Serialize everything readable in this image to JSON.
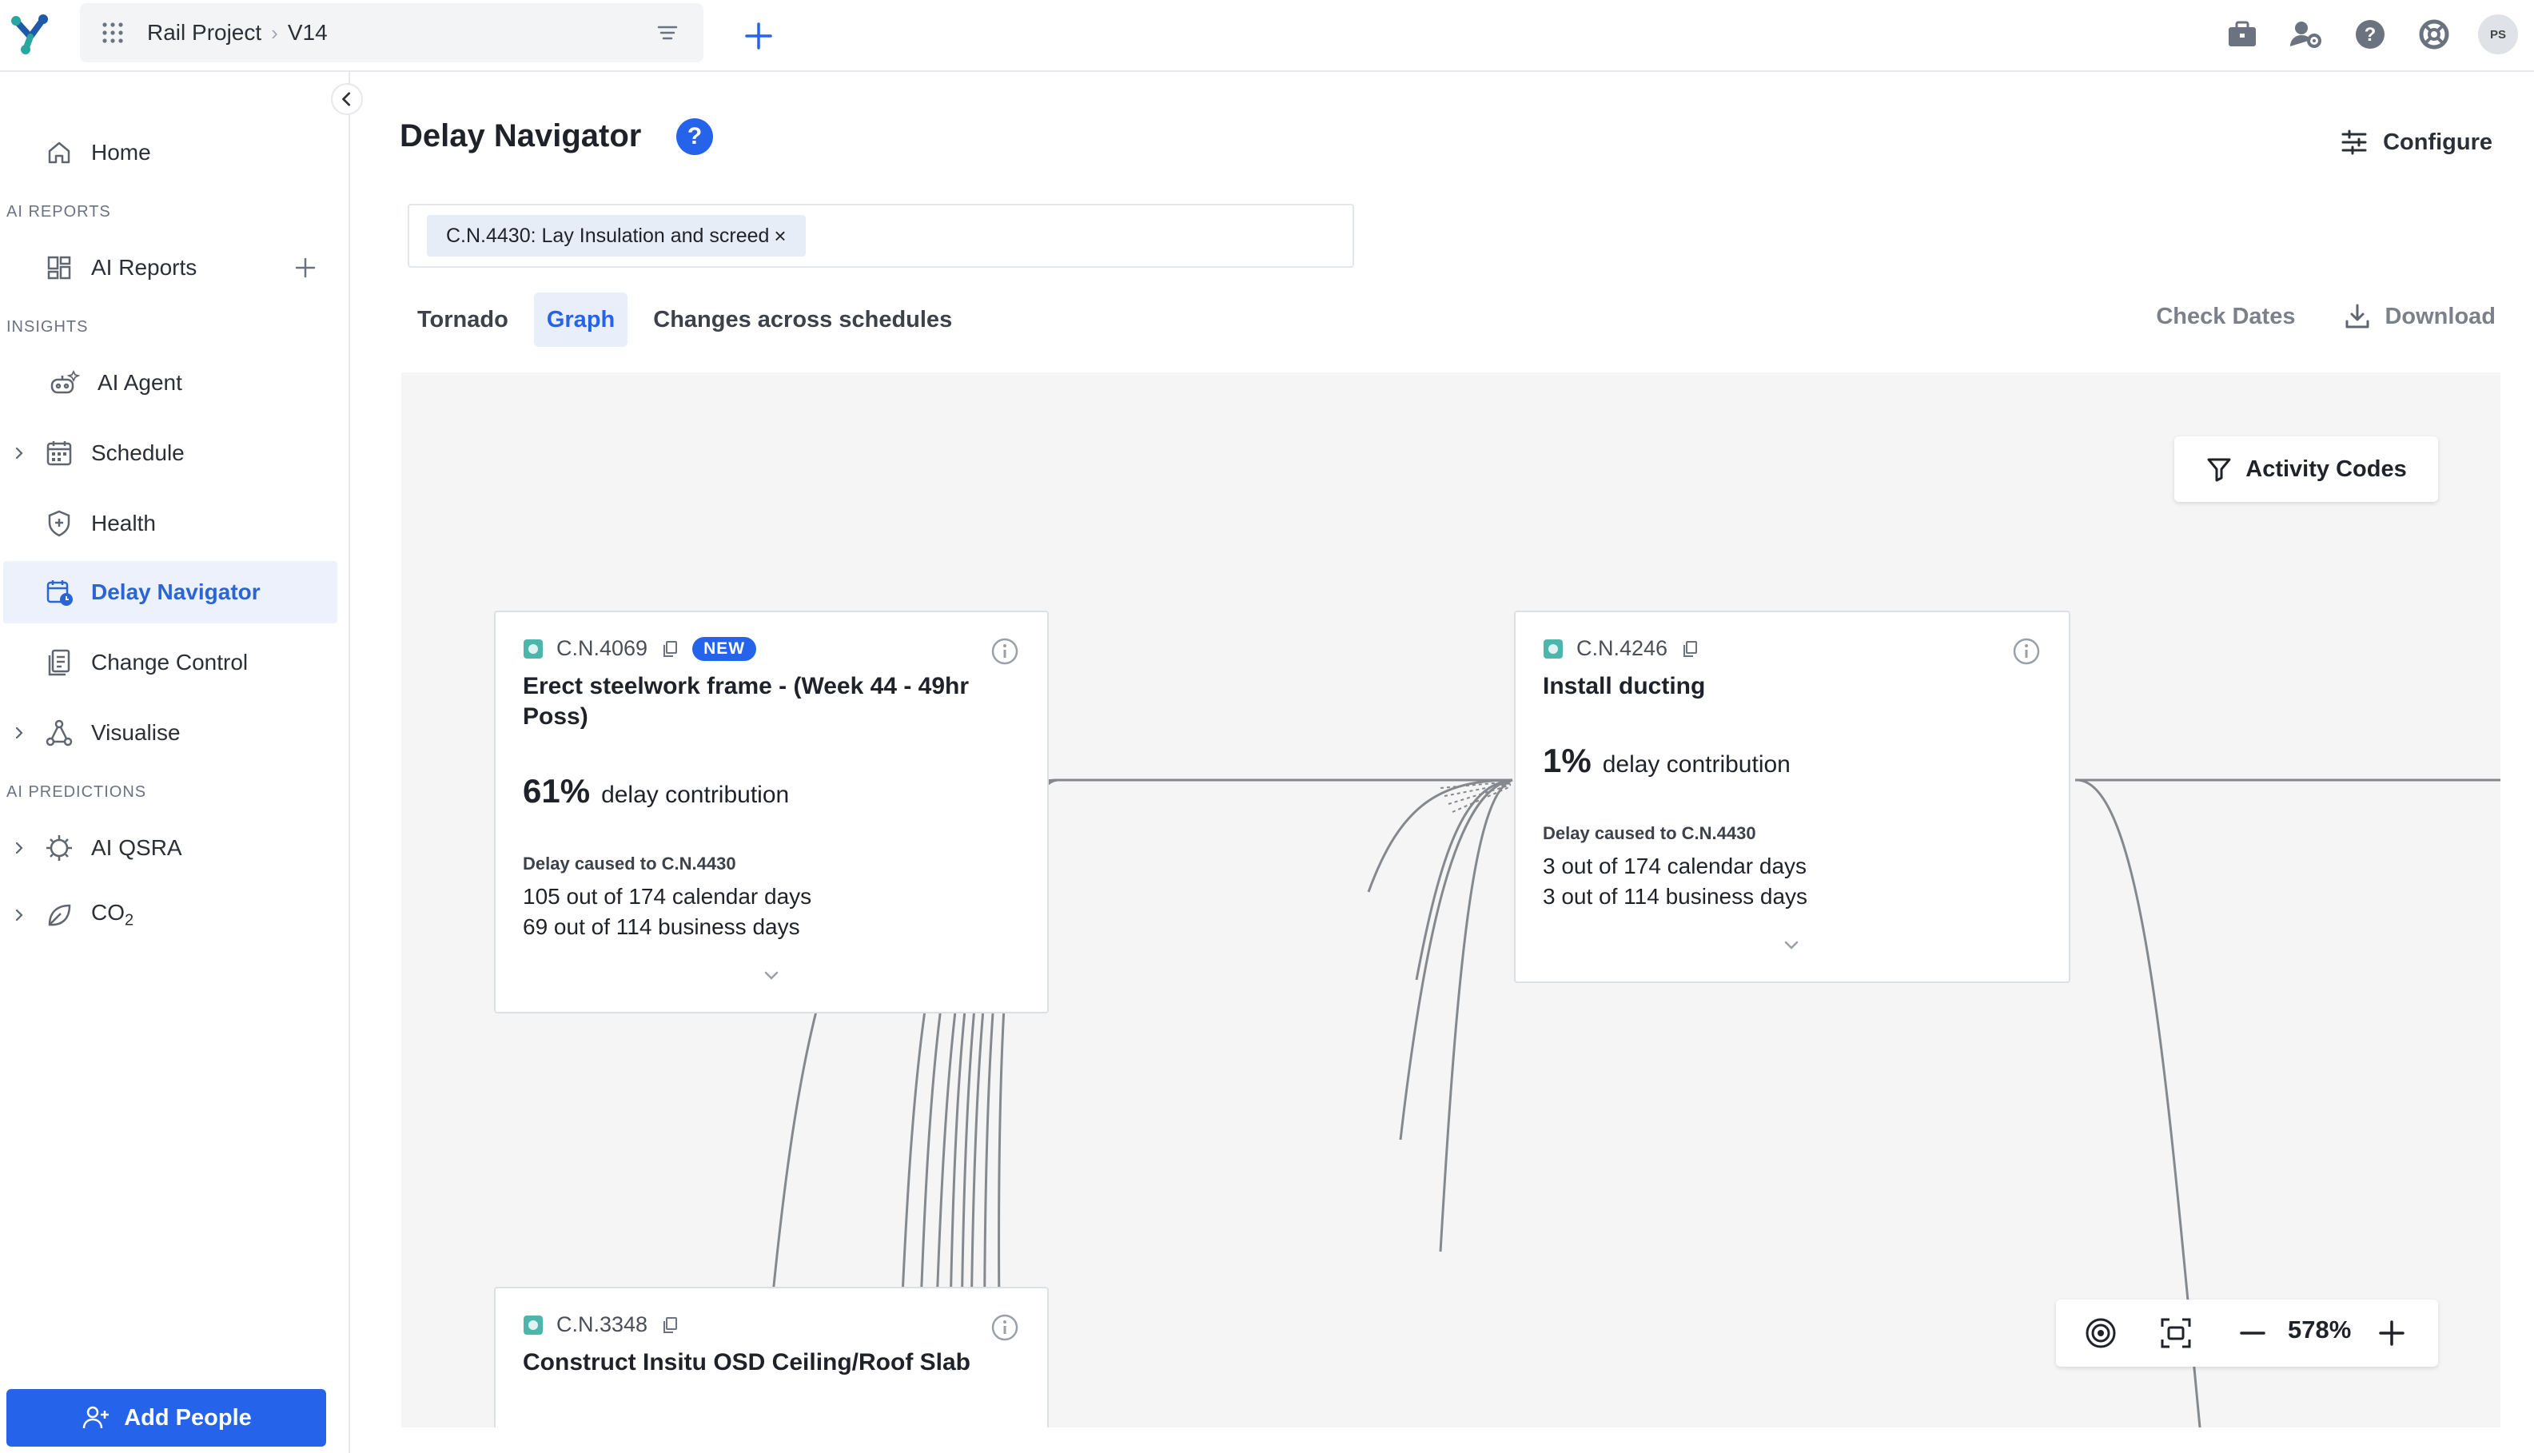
{
  "header": {
    "project": "Rail Project",
    "version": "V14",
    "avatar_initials": "PS"
  },
  "sidebar": {
    "sections": {
      "ai_reports": "AI REPORTS",
      "insights": "INSIGHTS",
      "ai_predictions": "AI PREDICTIONS"
    },
    "items": [
      {
        "label": "Home"
      },
      {
        "label": "AI Reports"
      },
      {
        "label": "AI Agent"
      },
      {
        "label": "Schedule"
      },
      {
        "label": "Health"
      },
      {
        "label": "Delay Navigator"
      },
      {
        "label": "Change Control"
      },
      {
        "label": "Visualise"
      },
      {
        "label": "AI QSRA"
      },
      {
        "label": "CO",
        "sub": "2"
      }
    ],
    "add_people": "Add People"
  },
  "main": {
    "title": "Delay Navigator",
    "help": "?",
    "configure": "Configure",
    "filter_chip": "C.N.4430: Lay Insulation and screed",
    "chip_close": "×",
    "tabs": [
      {
        "label": "Tornado"
      },
      {
        "label": "Graph"
      },
      {
        "label": "Changes across schedules"
      }
    ],
    "active_tab": "Graph",
    "check_dates": "Check Dates",
    "download": "Download"
  },
  "graph": {
    "activity_codes": "Activity Codes",
    "zoom": "578%",
    "accent_color": "#2563eb",
    "node_color": "#4db6ac",
    "cards": [
      {
        "id": "C.N.4069",
        "badge": "NEW",
        "name_line1": "Erect steelwork frame - (Week 44 - 49hr",
        "name_line2": "Poss)",
        "pct": "61%",
        "pct_label": "delay contribution",
        "delay_caused": "Delay caused to C.N.4430",
        "calendar": "105 out of 174 calendar days",
        "business": "69 out of 114 business days"
      },
      {
        "id": "C.N.4246",
        "name_line1": "Install ducting",
        "pct": "1%",
        "pct_label": "delay contribution",
        "delay_caused": "Delay caused to C.N.4430",
        "calendar": "3 out of 174 calendar days",
        "business": "3 out of 114 business days"
      },
      {
        "id": "C.N.3348",
        "name_line1": "Construct Insitu OSD Ceiling/Roof Slab"
      }
    ]
  }
}
